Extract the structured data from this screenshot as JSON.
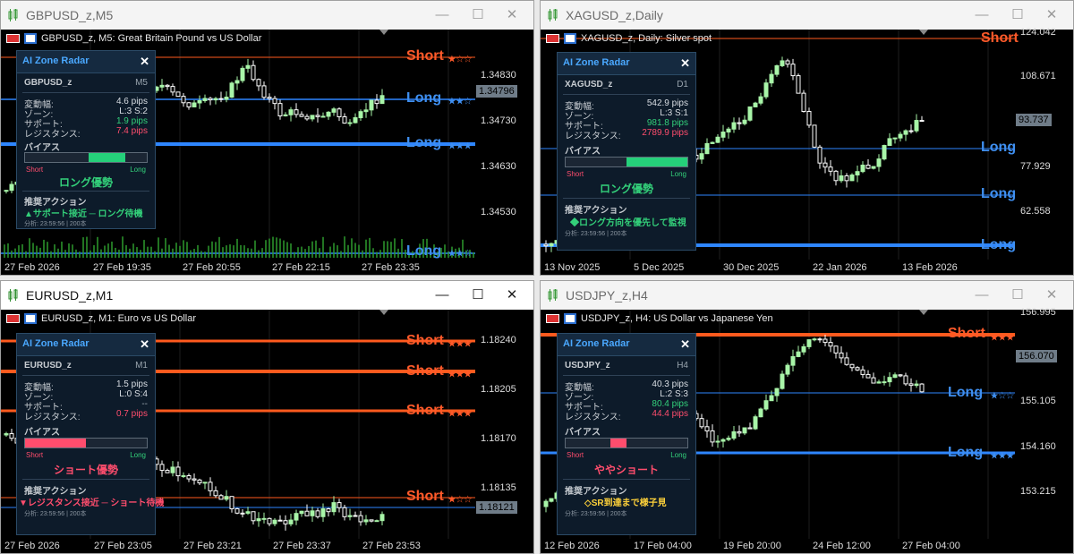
{
  "colors": {
    "bull": "#a8f5a8",
    "bear": "#ffffff",
    "short_line": "#ff5a1e",
    "long_line": "#2e86ff",
    "grid": "#2a2a2a",
    "bias_long": "#25d07a",
    "bias_short": "#ff4d6d"
  },
  "windows": [
    {
      "title": "GBPUSD_z,M5",
      "active": false,
      "header": "GBPUSD_z, M5:  Great Britain Pound vs US Dollar",
      "y_ticks": [
        "1.34830",
        "1.34730",
        "1.34630",
        "1.34530"
      ],
      "price_tag": "1.34796",
      "x_ticks": [
        "27 Feb 2026",
        "27 Feb 19:35",
        "27 Feb 20:55",
        "27 Feb 22:15",
        "27 Feb 23:35"
      ],
      "levels": [
        {
          "label": "Short",
          "stars": "★☆☆",
          "kind": "short"
        },
        {
          "label": "Long",
          "stars": "★★☆",
          "kind": "long"
        },
        {
          "label": "Long",
          "stars": "★★★",
          "kind": "long"
        },
        {
          "label": "Long",
          "stars": "★★☆",
          "kind": "long"
        }
      ],
      "panel": {
        "title": "AI Zone Radar",
        "symbol": "GBPUSD_z",
        "tf": "M5",
        "rows": [
          {
            "k": "変動幅:",
            "v": "4.6 pips"
          },
          {
            "k": "ゾーン:",
            "v": "L:3  S:2"
          },
          {
            "k": "サポート:",
            "v": "1.9 pips"
          },
          {
            "k": "レジスタンス:",
            "v": "7.4 pips"
          }
        ],
        "bias_label": "バイアス",
        "bias_short": "Short",
        "bias_long": "Long",
        "bias_fill": 0.42,
        "bias_kind": "long",
        "bias_text": "ロング優勢",
        "action_label": "推奨アクション",
        "action_text": "▲サポート接近 ─ ロング待機",
        "footer": "分析: 23:59:56 | 200本"
      }
    },
    {
      "title": "XAGUSD_z,Daily",
      "active": false,
      "header": "XAGUSD_z, Daily:  Silver spot",
      "y_ticks": [
        "124.042",
        "108.671",
        "77.929",
        "62.558"
      ],
      "price_tag": "93.737",
      "x_ticks": [
        "13 Nov 2025",
        "5 Dec 2025",
        "30 Dec 2025",
        "22 Jan 2026",
        "13 Feb 2026"
      ],
      "levels": [
        {
          "label": "Short",
          "stars": "",
          "kind": "short"
        },
        {
          "label": "Long",
          "stars": "",
          "kind": "long"
        },
        {
          "label": "Long",
          "stars": "",
          "kind": "long"
        },
        {
          "label": "Long",
          "stars": "",
          "kind": "long"
        }
      ],
      "panel": {
        "title": "AI Zone Radar",
        "symbol": "XAGUSD_z",
        "tf": "D1",
        "rows": [
          {
            "k": "変動幅:",
            "v": "542.9 pips"
          },
          {
            "k": "ゾーン:",
            "v": "L:3  S:1"
          },
          {
            "k": "サポート:",
            "v": "981.8 pips"
          },
          {
            "k": "レジスタンス:",
            "v": "2789.9 pips"
          }
        ],
        "bias_label": "バイアス",
        "bias_short": "Short",
        "bias_long": "Long",
        "bias_fill": 0.5,
        "bias_kind": "long",
        "bias_text": "ロング優勢",
        "action_label": "推奨アクション",
        "action_text": "◆ロング方向を優先して監視",
        "footer": "分析: 23:59:56 | 200本"
      }
    },
    {
      "title": "EURUSD_z,M1",
      "active": true,
      "header": "EURUSD_z, M1:  Euro vs US Dollar",
      "y_ticks": [
        "1.18240",
        "1.18205",
        "1.18170",
        "1.18135"
      ],
      "price_tag": "1.18121",
      "x_ticks": [
        "27 Feb 2026",
        "27 Feb 23:05",
        "27 Feb 23:21",
        "27 Feb 23:37",
        "27 Feb 23:53"
      ],
      "levels": [
        {
          "label": "Short",
          "stars": "★★★",
          "kind": "short"
        },
        {
          "label": "Short",
          "stars": "★★★",
          "kind": "short"
        },
        {
          "label": "Short",
          "stars": "★★★",
          "kind": "short"
        },
        {
          "label": "Short",
          "stars": "★☆☆",
          "kind": "short"
        }
      ],
      "panel": {
        "title": "AI Zone Radar",
        "symbol": "EURUSD_z",
        "tf": "M1",
        "rows": [
          {
            "k": "変動幅:",
            "v": "1.5 pips"
          },
          {
            "k": "ゾーン:",
            "v": "L:0  S:4"
          },
          {
            "k": "サポート:",
            "v": "--"
          },
          {
            "k": "レジスタンス:",
            "v": "0.7 pips"
          }
        ],
        "bias_label": "バイアス",
        "bias_short": "Short",
        "bias_long": "Long",
        "bias_fill": 0.5,
        "bias_kind": "short",
        "bias_text": "ショート優勢",
        "action_label": "推奨アクション",
        "action_text": "▼レジスタンス接近 ─ ショート待機",
        "footer": "分析: 23:59:56 | 200本"
      }
    },
    {
      "title": "USDJPY_z,H4",
      "active": false,
      "header": "USDJPY_z, H4:  US Dollar vs Japanese Yen",
      "y_ticks": [
        "156.995",
        "155.105",
        "154.160",
        "153.215"
      ],
      "price_tag": "156.070",
      "x_ticks": [
        "12 Feb 2026",
        "17 Feb 04:00",
        "19 Feb 20:00",
        "24 Feb 12:00",
        "27 Feb 04:00"
      ],
      "levels": [
        {
          "label": "Short",
          "stars": "★★★",
          "kind": "short"
        },
        {
          "label": "Long",
          "stars": "★☆☆",
          "kind": "long"
        },
        {
          "label": "Long",
          "stars": "★★★",
          "kind": "long"
        }
      ],
      "panel": {
        "title": "AI Zone Radar",
        "symbol": "USDJPY_z",
        "tf": "H4",
        "rows": [
          {
            "k": "変動幅:",
            "v": "40.3 pips"
          },
          {
            "k": "ゾーン:",
            "v": "L:2  S:3"
          },
          {
            "k": "サポート:",
            "v": "80.4 pips"
          },
          {
            "k": "レジスタンス:",
            "v": "44.4 pips"
          }
        ],
        "bias_label": "バイアス",
        "bias_short": "Short",
        "bias_long": "Long",
        "bias_fill": 0.15,
        "bias_kind": "short",
        "bias_text": "ややショート",
        "action_label": "推奨アクション",
        "action_text": "◇SR到達まで様子見",
        "footer": "分析: 23:59:56 | 200本"
      }
    }
  ]
}
